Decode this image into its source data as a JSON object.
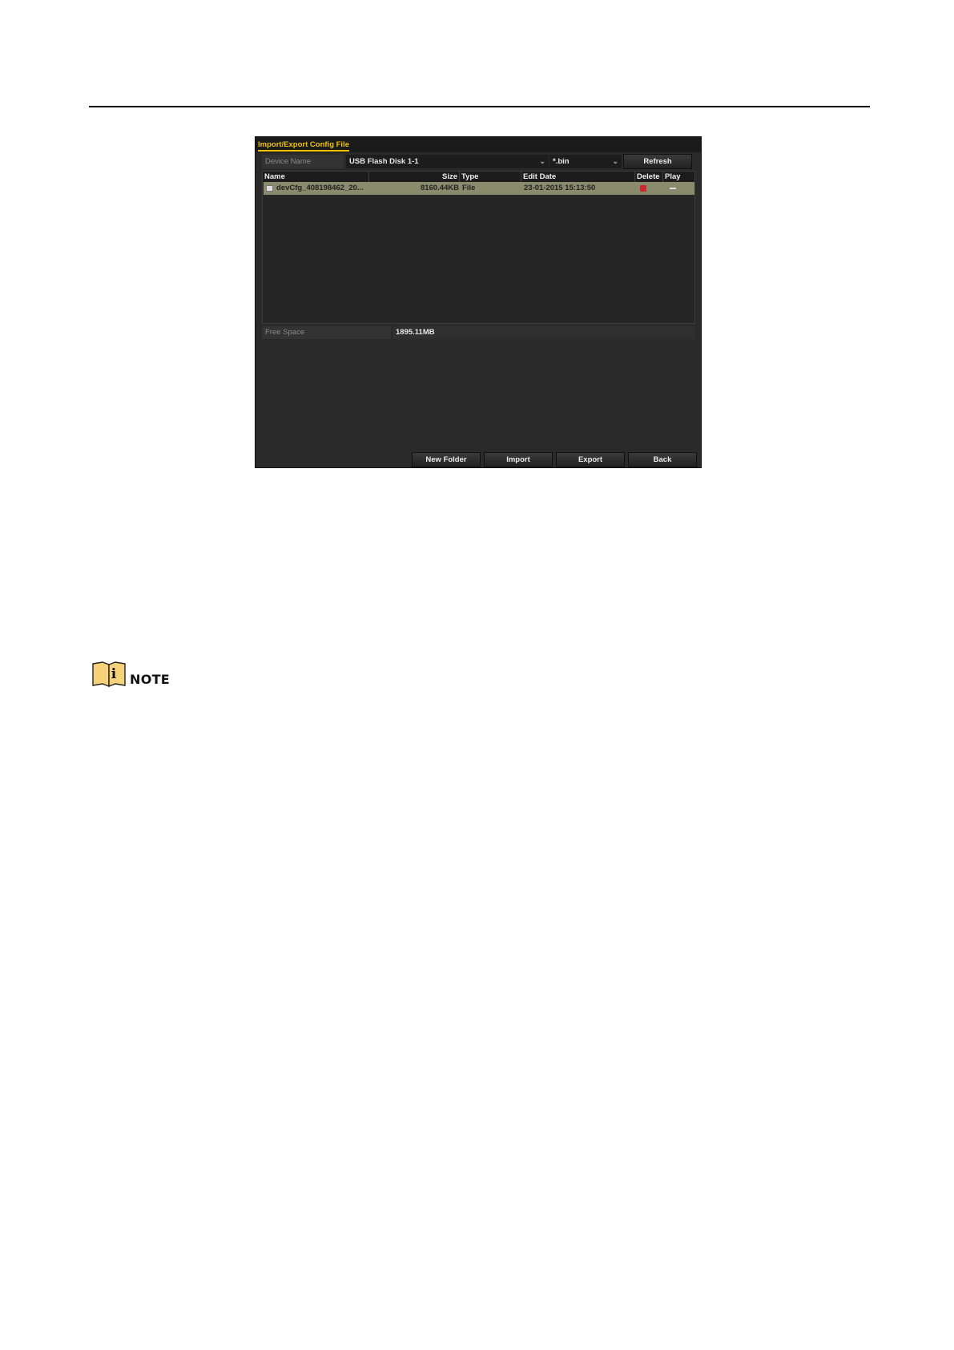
{
  "window": {
    "title": "Import/Export Config File"
  },
  "toolbar": {
    "device_label": "Device Name",
    "device_value": "USB Flash Disk 1-1",
    "filter_value": "*.bin",
    "refresh_label": "Refresh"
  },
  "table": {
    "columns": [
      "Name",
      "Size",
      "Type",
      "Edit Date",
      "Delete",
      "Play"
    ],
    "rows": [
      {
        "name": "devCfg_408198462_20...",
        "size": "8160.44KB",
        "type": "File",
        "edit_date": "23-01-2015 15:13:50"
      }
    ]
  },
  "free_space": {
    "label": "Free Space",
    "value": "1895.11MB"
  },
  "buttons": {
    "new_folder": "New Folder",
    "import": "Import",
    "export": "Export",
    "back": "Back"
  },
  "note": {
    "label": "NOTE"
  },
  "colors": {
    "accent": "#f2c200",
    "selected_row": "#8a8a6d",
    "delete": "#d0282a"
  }
}
